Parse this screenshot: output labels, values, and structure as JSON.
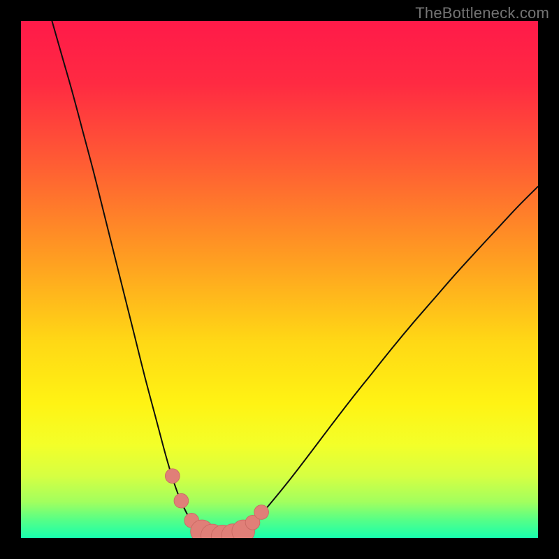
{
  "watermark": {
    "text": "TheBottleneck.com"
  },
  "colors": {
    "background_outer": "#000000",
    "gradient_stops": [
      {
        "offset": 0.0,
        "color": "#ff1a49"
      },
      {
        "offset": 0.12,
        "color": "#ff2a42"
      },
      {
        "offset": 0.28,
        "color": "#ff5e33"
      },
      {
        "offset": 0.45,
        "color": "#ff9a22"
      },
      {
        "offset": 0.62,
        "color": "#ffd815"
      },
      {
        "offset": 0.74,
        "color": "#fff314"
      },
      {
        "offset": 0.82,
        "color": "#f3ff29"
      },
      {
        "offset": 0.88,
        "color": "#d6ff42"
      },
      {
        "offset": 0.93,
        "color": "#a2ff5e"
      },
      {
        "offset": 0.965,
        "color": "#56ff87"
      },
      {
        "offset": 1.0,
        "color": "#18ffad"
      }
    ],
    "curve_stroke": "#0e0e0e",
    "marker_fill": "#e07f78",
    "marker_stroke": "#c96a63"
  },
  "chart_data": {
    "type": "line",
    "title": "",
    "xlabel": "",
    "ylabel": "",
    "xlim": [
      0,
      100
    ],
    "ylim": [
      0,
      100
    ],
    "grid": false,
    "legend": false,
    "series": [
      {
        "name": "left-branch",
        "x": [
          6,
          8,
          10,
          12,
          14,
          16,
          18,
          20,
          22,
          24,
          26,
          28,
          29.5,
          31,
          33,
          35
        ],
        "y": [
          100,
          93,
          86,
          78.5,
          71,
          63,
          55,
          47,
          39,
          31,
          23.5,
          16,
          11,
          7,
          3.2,
          1.2
        ]
      },
      {
        "name": "valley-floor",
        "x": [
          35,
          36,
          37,
          38,
          39,
          40,
          41,
          42,
          43
        ],
        "y": [
          1.2,
          0.7,
          0.45,
          0.35,
          0.3,
          0.35,
          0.5,
          0.8,
          1.3
        ]
      },
      {
        "name": "right-branch",
        "x": [
          43,
          45,
          48,
          52,
          56,
          60,
          64,
          68,
          72,
          76,
          80,
          84,
          88,
          92,
          96,
          100
        ],
        "y": [
          1.3,
          3.0,
          6.4,
          11.3,
          16.5,
          21.8,
          27.0,
          32.0,
          37.0,
          41.8,
          46.4,
          51.0,
          55.4,
          59.7,
          64.0,
          68.0
        ]
      }
    ],
    "markers": {
      "name": "valley-markers",
      "x": [
        29.3,
        31.0,
        33.0,
        35.0,
        37.0,
        39.0,
        41.0,
        43.0,
        44.8,
        46.5
      ],
      "y": [
        12.0,
        7.2,
        3.4,
        1.3,
        0.5,
        0.3,
        0.55,
        1.3,
        3.0,
        5.0
      ],
      "r_small": 1.4,
      "r_large": 2.2,
      "large_indices": [
        3,
        4,
        5,
        6,
        7
      ]
    }
  }
}
